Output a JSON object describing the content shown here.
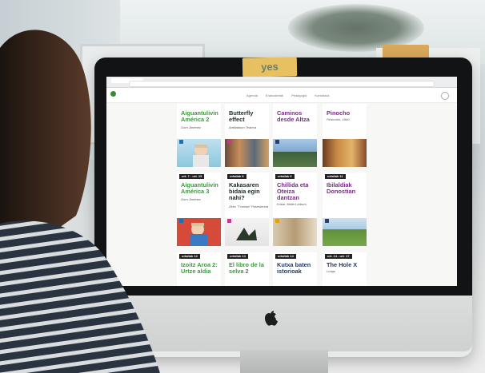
{
  "sticky_note": "yes",
  "site": {
    "nav": [
      "Agenda",
      "Erakusketak",
      "Pedagogia",
      "Kontaktua"
    ]
  },
  "cards": [
    {
      "title": "Aiguantulivin América 2",
      "subtitle": "Gorn Jiménez",
      "date": ""
    },
    {
      "title": "Butterfly effect",
      "subtitle": "Antiliabium Teatroa",
      "date": ""
    },
    {
      "title": "Caminos desde Altza",
      "subtitle": "",
      "date": ""
    },
    {
      "title": "Pinocho",
      "subtitle": "Pinocchio, 1940",
      "date": ""
    },
    {
      "title": "Aiguantulivin América 3",
      "subtitle": "Gorn Jiménez",
      "date": "urt. 7 - urt. 15"
    },
    {
      "title": "Kakasaren bidaia egin nahi?",
      "subtitle": "Zirko \"Txmista\" Pasestoriua",
      "date": "urtailak 6"
    },
    {
      "title": "Chillida eta Oteiza dantzan",
      "subtitle": "Kukai, Maite Larburu",
      "date": "urtailak 6"
    },
    {
      "title": "Ibilaldiak Donostian",
      "subtitle": "",
      "date": "urtailak 11"
    },
    {
      "title": "Izoitz Aroa 2: Urtze aldia",
      "subtitle": "",
      "date": "urtailak 12"
    },
    {
      "title": "El libro de la selva 2",
      "subtitle": "",
      "date": "urtailak 14"
    },
    {
      "title": "Kutxa baten istorioak",
      "subtitle": "",
      "date": "urtailak 14"
    },
    {
      "title": "The Hole X",
      "subtitle": "Longo",
      "date": "urt. 14 - urt. 17"
    }
  ],
  "colors": {
    "green": "#3b9a3c",
    "purple": "#7a2b8a",
    "navy": "#233a6a",
    "dark": "#1f2a2a"
  }
}
